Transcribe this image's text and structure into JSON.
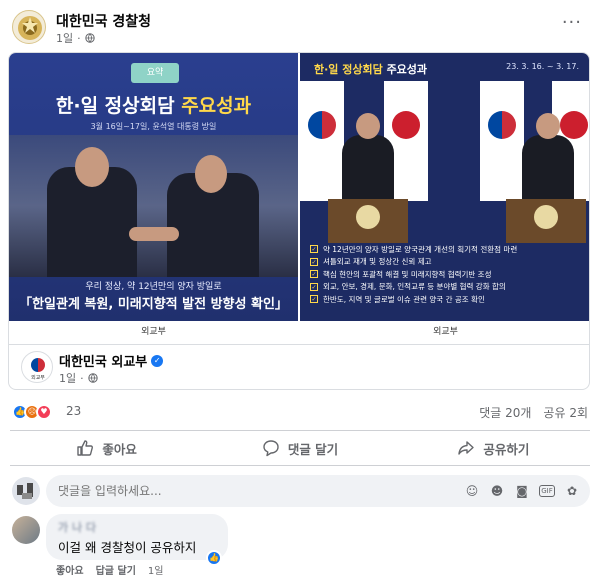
{
  "post": {
    "page_name": "대한민국 경찰청",
    "time": "1일",
    "more": "···"
  },
  "shared": {
    "left_image": {
      "brand": "요약",
      "title_main": "한·일 정상회담 ",
      "title_accent": "주요성과",
      "date": "3월 16일~17일, 윤석열 대통령 방일",
      "sub": "우리 정상, 약 12년만의 양자 방일로",
      "headline": "「한일관계 복원, 미래지향적 발전 방향성 확인」",
      "footer": "외교부"
    },
    "right_image": {
      "title_accent": "한·일 정상회담",
      "title_main": " 주요성과",
      "date": "23. 3. 16. ~ 3. 17.",
      "bullets": [
        "약 12년만의 양자 방일로 양국관계 개선의 획기적 전환점 마련",
        "셔틀외교 재개 및 정상간 신뢰 제고",
        "핵심 현안의 포괄적 해결 및 미래지향적 협력기반 조성",
        "외교, 안보, 경제, 문화, 인적교류 등 분야별 협력 강화 합의",
        "한반도, 지역 및 글로벌 이슈 관련 양국 간 공조 확인"
      ],
      "footer": "외교부"
    },
    "page_name": "대한민국 외교부",
    "avatar_label": "외교부",
    "time": "1일"
  },
  "engagement": {
    "reaction_count": "23",
    "comments": "댓글 20개",
    "shares": "공유 2회"
  },
  "actions": {
    "like": "좋아요",
    "comment": "댓글 달기",
    "share": "공유하기"
  },
  "compose": {
    "placeholder": "댓글을 입력하세요..."
  },
  "comment": {
    "author": "가 나 다",
    "text": "이걸 왜 경찰청이 공유하지",
    "like": "좋아요",
    "reply": "답글 달기",
    "time": "1일"
  },
  "colors": {
    "accent": "#1877f2",
    "poster_navy": "#26387f",
    "poster_yellow": "#ffd84a"
  }
}
